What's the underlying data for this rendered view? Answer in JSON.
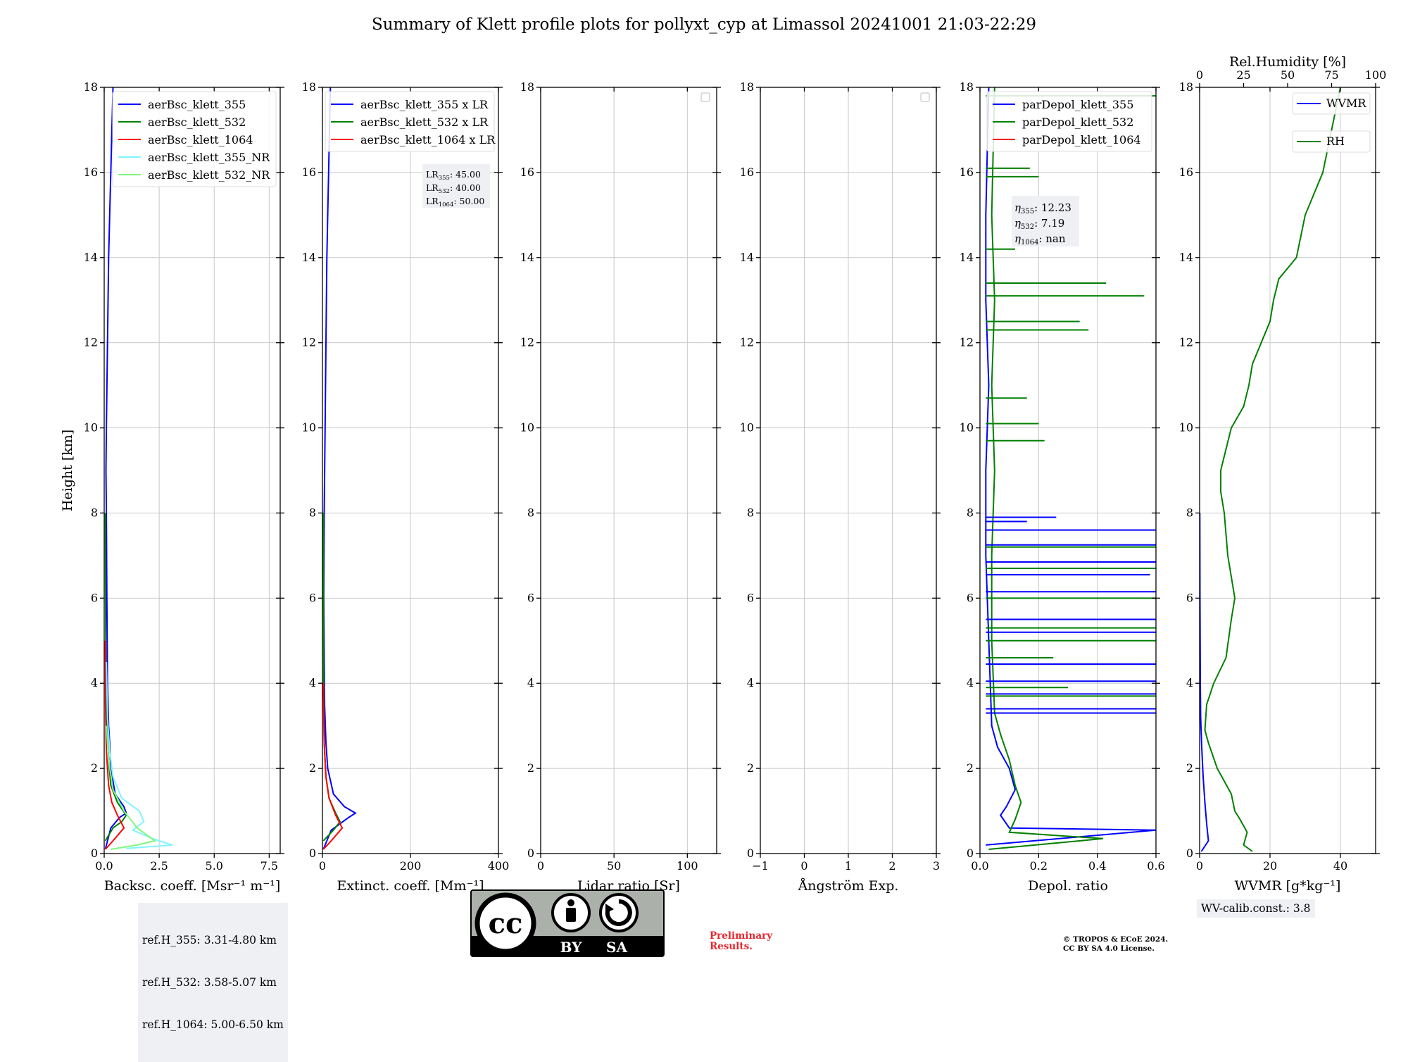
{
  "title": "Summary of Klett profile plots for pollyxt_cyp at Limassol 20241001 21:03-22:29",
  "ylabel": "Height [km]",
  "colors": {
    "c355": "#0000ff",
    "c532": "#008000",
    "c1064": "#ff0000",
    "c355nr": "#7ff5ff",
    "c532nr": "#7ff77f"
  },
  "ref_heights": [
    "ref.H_355: 3.31-4.80 km",
    "ref.H_532: 3.58-5.07 km",
    "ref.H_1064: 5.00-6.50 km"
  ],
  "wv_calib": "WV-calib.const.: 3.8",
  "preliminary": "Preliminary\nResults.",
  "copyright": "© TROPOS & ECoE 2024.\nCC BY SA 4.0 License.",
  "license_badge": {
    "by": "BY",
    "sa": "SA",
    "cc": "cc"
  },
  "chart_data": [
    {
      "type": "line",
      "xlabel": "Backsc. coeff. [Msr⁻¹ m⁻¹]",
      "ylabel": "Height [km]",
      "xlim": [
        0,
        8
      ],
      "ylim": [
        0,
        18
      ],
      "xticks": [
        0.0,
        2.5,
        5.0,
        7.5
      ],
      "xticklabels": [
        "0.0",
        "2.5",
        "5.0",
        "7.5"
      ],
      "yticks": [
        0,
        2,
        4,
        6,
        8,
        10,
        12,
        14,
        16,
        18
      ],
      "legend": "top-right",
      "grid": true,
      "series": [
        {
          "name": "aerBsc_klett_355",
          "color": "#0000ff",
          "x": [
            0.05,
            0.3,
            0.7,
            1.0,
            0.9,
            0.5,
            0.3,
            0.25,
            0.2,
            0.15,
            0.12,
            0.1,
            0.08,
            0.1,
            0.15,
            0.2,
            0.25,
            0.3,
            0.35,
            0.4
          ],
          "y": [
            0.1,
            0.6,
            0.85,
            0.95,
            1.1,
            1.4,
            2.0,
            2.6,
            3.0,
            4.0,
            6.0,
            8.0,
            9.0,
            10.0,
            12.0,
            14.0,
            15.0,
            16.0,
            17.0,
            18.0
          ]
        },
        {
          "name": "aerBsc_klett_532",
          "color": "#008000",
          "x": [
            0.05,
            0.4,
            0.8,
            1.0,
            0.6,
            0.3,
            0.2,
            0.12,
            0.08,
            0.06,
            0.05
          ],
          "y": [
            0.3,
            0.6,
            0.75,
            0.9,
            1.2,
            1.6,
            2.2,
            3.0,
            4.0,
            6.0,
            8.0
          ]
        },
        {
          "name": "aerBsc_klett_1064",
          "color": "#ff0000",
          "x": [
            0.05,
            0.4,
            0.9,
            0.6,
            0.35,
            0.2,
            0.1,
            0.06,
            0.05
          ],
          "y": [
            0.1,
            0.3,
            0.6,
            0.9,
            1.2,
            1.6,
            2.4,
            3.5,
            5.0
          ]
        },
        {
          "name": "aerBsc_klett_355_NR",
          "color": "#7ff5ff",
          "x": [
            1.0,
            3.1,
            2.2,
            1.3,
            1.8,
            1.6,
            0.8,
            0.4,
            0.25,
            0.15,
            0.1
          ],
          "y": [
            0.12,
            0.2,
            0.35,
            0.55,
            0.75,
            1.0,
            1.3,
            1.8,
            2.4,
            3.2,
            4.5
          ]
        },
        {
          "name": "aerBsc_klett_532_NR",
          "color": "#7ff77f",
          "x": [
            0.3,
            1.5,
            2.3,
            1.5,
            0.9,
            0.4,
            0.2,
            0.1
          ],
          "y": [
            0.1,
            0.2,
            0.3,
            0.6,
            1.0,
            1.5,
            2.2,
            3.0
          ]
        }
      ],
      "annotation": ""
    },
    {
      "type": "line",
      "xlabel": "Extinct. coeff. [Mm⁻¹]",
      "xlim": [
        0,
        400
      ],
      "ylim": [
        0,
        18
      ],
      "xticks": [
        0,
        200,
        400
      ],
      "xticklabels": [
        "0",
        "200",
        "400"
      ],
      "yticks": [
        0,
        2,
        4,
        6,
        8,
        10,
        12,
        14,
        16,
        18
      ],
      "legend": "top-right",
      "grid": true,
      "series": [
        {
          "name": "aerBsc_klett_355 x LR",
          "color": "#0000ff",
          "x": [
            2,
            20,
            60,
            75,
            50,
            25,
            12,
            8,
            5,
            3,
            4,
            6,
            8,
            10,
            12,
            14,
            16,
            18
          ],
          "y": [
            0.1,
            0.55,
            0.85,
            0.95,
            1.1,
            1.4,
            2.0,
            2.6,
            3.5,
            6.0,
            8.0,
            10.0,
            12.0,
            14.0,
            15.0,
            16.0,
            17.0,
            18.0
          ]
        },
        {
          "name": "aerBsc_klett_532 x LR",
          "color": "#008000",
          "x": [
            2,
            25,
            40,
            30,
            15,
            8,
            4,
            3,
            2
          ],
          "y": [
            0.3,
            0.55,
            0.75,
            0.95,
            1.3,
            1.8,
            2.6,
            4.0,
            8.0
          ]
        },
        {
          "name": "aerBsc_klett_1064 x LR",
          "color": "#ff0000",
          "x": [
            2,
            20,
            45,
            30,
            15,
            8,
            4,
            2
          ],
          "y": [
            0.1,
            0.3,
            0.6,
            0.9,
            1.3,
            1.8,
            2.6,
            4.0
          ]
        }
      ],
      "annotation": "LR355: 45.00 / LR532: 40.00 / LR1064: 50.00"
    },
    {
      "type": "line",
      "xlabel": "Lidar ratio [Sr]",
      "xlim": [
        0,
        120
      ],
      "ylim": [
        0,
        18
      ],
      "xticks": [
        0,
        50,
        100
      ],
      "xticklabels": [
        "0",
        "50",
        "100"
      ],
      "yticks": [
        0,
        2,
        4,
        6,
        8,
        10,
        12,
        14,
        16,
        18
      ],
      "legend": "top-right",
      "grid": true,
      "series": []
    },
    {
      "type": "line",
      "xlabel": "Ångström Exp.",
      "xlim": [
        -1,
        3
      ],
      "ylim": [
        0,
        18
      ],
      "xticks": [
        -1,
        0,
        1,
        2,
        3
      ],
      "xticklabels": [
        "−1",
        "0",
        "1",
        "2",
        "3"
      ],
      "yticks": [
        0,
        2,
        4,
        6,
        8,
        10,
        12,
        14,
        16,
        18
      ],
      "legend": "top-right",
      "grid": true,
      "series": []
    },
    {
      "type": "line",
      "xlabel": "Depol. ratio",
      "xlim": [
        0,
        0.6
      ],
      "ylim": [
        0,
        18
      ],
      "xticks": [
        0.0,
        0.2,
        0.4,
        0.6
      ],
      "xticklabels": [
        "0.0",
        "0.2",
        "0.4",
        "0.6"
      ],
      "yticks": [
        0,
        2,
        4,
        6,
        8,
        10,
        12,
        14,
        16,
        18
      ],
      "legend": "top-right",
      "grid": true,
      "series": [
        {
          "name": "parDepol_klett_355",
          "color": "#0000ff",
          "x": [
            0.02,
            0.6,
            0.1,
            0.07,
            0.09,
            0.12,
            0.1,
            0.06,
            0.04,
            0.03,
            0.02,
            0.02,
            0.03,
            0.02,
            0.02,
            0.03
          ],
          "y": [
            0.2,
            0.55,
            0.6,
            0.9,
            1.1,
            1.5,
            2.0,
            2.5,
            3.0,
            5.0,
            7.0,
            9.0,
            11.0,
            13.0,
            15.0,
            18.0
          ]
        },
        {
          "name": "parDepol_klett_532",
          "color": "#008000",
          "x": [
            0.03,
            0.42,
            0.1,
            0.12,
            0.14,
            0.12,
            0.1,
            0.07,
            0.05,
            0.04,
            0.04,
            0.05,
            0.04,
            0.05,
            0.04,
            0.05
          ],
          "y": [
            0.1,
            0.35,
            0.5,
            0.8,
            1.2,
            1.6,
            2.2,
            2.8,
            3.3,
            5.0,
            7.0,
            9.0,
            11.0,
            13.0,
            15.0,
            18.0
          ]
        },
        {
          "name": "parDepol_klett_1064",
          "color": "#ff0000",
          "x": [],
          "y": []
        }
      ],
      "spikes": [
        {
          "color": "#0000ff",
          "x": 0.6,
          "y": 3.3
        },
        {
          "color": "#0000ff",
          "x": 0.6,
          "y": 3.4
        },
        {
          "color": "#0000ff",
          "x": 0.6,
          "y": 3.75
        },
        {
          "color": "#0000ff",
          "x": 0.6,
          "y": 4.05
        },
        {
          "color": "#0000ff",
          "x": 0.6,
          "y": 4.45
        },
        {
          "color": "#0000ff",
          "x": 0.6,
          "y": 5.2
        },
        {
          "color": "#0000ff",
          "x": 0.6,
          "y": 5.5
        },
        {
          "color": "#0000ff",
          "x": 0.6,
          "y": 6.15
        },
        {
          "color": "#0000ff",
          "x": 0.58,
          "y": 6.55
        },
        {
          "color": "#0000ff",
          "x": 0.6,
          "y": 6.85
        },
        {
          "color": "#0000ff",
          "x": 0.6,
          "y": 7.25
        },
        {
          "color": "#0000ff",
          "x": 0.6,
          "y": 7.6
        },
        {
          "color": "#0000ff",
          "x": 0.26,
          "y": 7.9
        },
        {
          "color": "#0000ff",
          "x": 0.16,
          "y": 7.8
        },
        {
          "color": "#008000",
          "x": 0.6,
          "y": 3.7
        },
        {
          "color": "#008000",
          "x": 0.6,
          "y": 5.0
        },
        {
          "color": "#008000",
          "x": 0.6,
          "y": 5.3
        },
        {
          "color": "#008000",
          "x": 0.6,
          "y": 6.0
        },
        {
          "color": "#008000",
          "x": 0.6,
          "y": 6.7
        },
        {
          "color": "#008000",
          "x": 0.6,
          "y": 7.2
        },
        {
          "color": "#008000",
          "x": 0.3,
          "y": 3.9
        },
        {
          "color": "#008000",
          "x": 0.25,
          "y": 4.6
        },
        {
          "color": "#008000",
          "x": 0.22,
          "y": 9.7
        },
        {
          "color": "#008000",
          "x": 0.16,
          "y": 10.7
        },
        {
          "color": "#008000",
          "x": 0.2,
          "y": 10.1
        },
        {
          "color": "#008000",
          "x": 0.37,
          "y": 12.3
        },
        {
          "color": "#008000",
          "x": 0.34,
          "y": 12.5
        },
        {
          "color": "#008000",
          "x": 0.56,
          "y": 13.1
        },
        {
          "color": "#008000",
          "x": 0.43,
          "y": 13.4
        },
        {
          "color": "#008000",
          "x": 0.12,
          "y": 14.2
        },
        {
          "color": "#008000",
          "x": 0.2,
          "y": 15.9
        },
        {
          "color": "#008000",
          "x": 0.17,
          "y": 16.1
        },
        {
          "color": "#008000",
          "x": 0.6,
          "y": 17.8
        }
      ],
      "annotation": "η355: 12.23 / η532: 7.19 / η1064: nan"
    },
    {
      "type": "line",
      "xlabel": "WVMR [g*kg⁻¹]",
      "x2label": "Rel.Humidity [%]",
      "xlim": [
        0,
        50
      ],
      "ylim": [
        0,
        18
      ],
      "xticks": [
        0,
        20,
        40
      ],
      "xticklabels": [
        "0",
        "20",
        "40"
      ],
      "x2lim": [
        0,
        100
      ],
      "x2ticks": [
        0,
        25,
        50,
        75,
        100
      ],
      "x2ticklabels": [
        "0",
        "25",
        "50",
        "75",
        "100"
      ],
      "yticks": [
        0,
        2,
        4,
        6,
        8,
        10,
        12,
        14,
        16,
        18
      ],
      "legend": "top-right",
      "grid": true,
      "series": [
        {
          "name": "WVMR",
          "axis": "bottom",
          "color": "#0000ff",
          "x": [
            0.5,
            2.5,
            2.0,
            1.5,
            1.0,
            0.6,
            0.3,
            0.2,
            0.1,
            0.05
          ],
          "y": [
            0.05,
            0.3,
            0.7,
            1.2,
            1.8,
            2.5,
            3.2,
            4.0,
            6.0,
            8.0
          ]
        },
        {
          "name": "RH",
          "axis": "top",
          "color": "#008000",
          "x": [
            30,
            25,
            27,
            23,
            20,
            18,
            10,
            5,
            3,
            4,
            8,
            15,
            18,
            20,
            16,
            14,
            12,
            12,
            15,
            18,
            25,
            28,
            30,
            35,
            40,
            42,
            45,
            55,
            60,
            70,
            75,
            80
          ],
          "y": [
            0.05,
            0.2,
            0.5,
            0.8,
            1.0,
            1.4,
            2.0,
            2.6,
            2.9,
            3.5,
            4.0,
            4.6,
            5.5,
            6.0,
            7.0,
            8.0,
            8.5,
            9.0,
            9.5,
            10.0,
            10.5,
            11.0,
            11.5,
            12.0,
            12.5,
            13.0,
            13.5,
            14.0,
            15.0,
            16.0,
            17.0,
            18.0
          ]
        }
      ],
      "annotation": ""
    }
  ],
  "panel_texts": {
    "lr": [
      "LR",
      "355",
      ": 45.00",
      "LR",
      "532",
      ": 40.00",
      "LR",
      "1064",
      ": 50.00"
    ],
    "eta": [
      "η",
      "355",
      ": 12.23",
      "η",
      "532",
      ": 7.19",
      "η",
      "1064",
      ": nan"
    ]
  }
}
